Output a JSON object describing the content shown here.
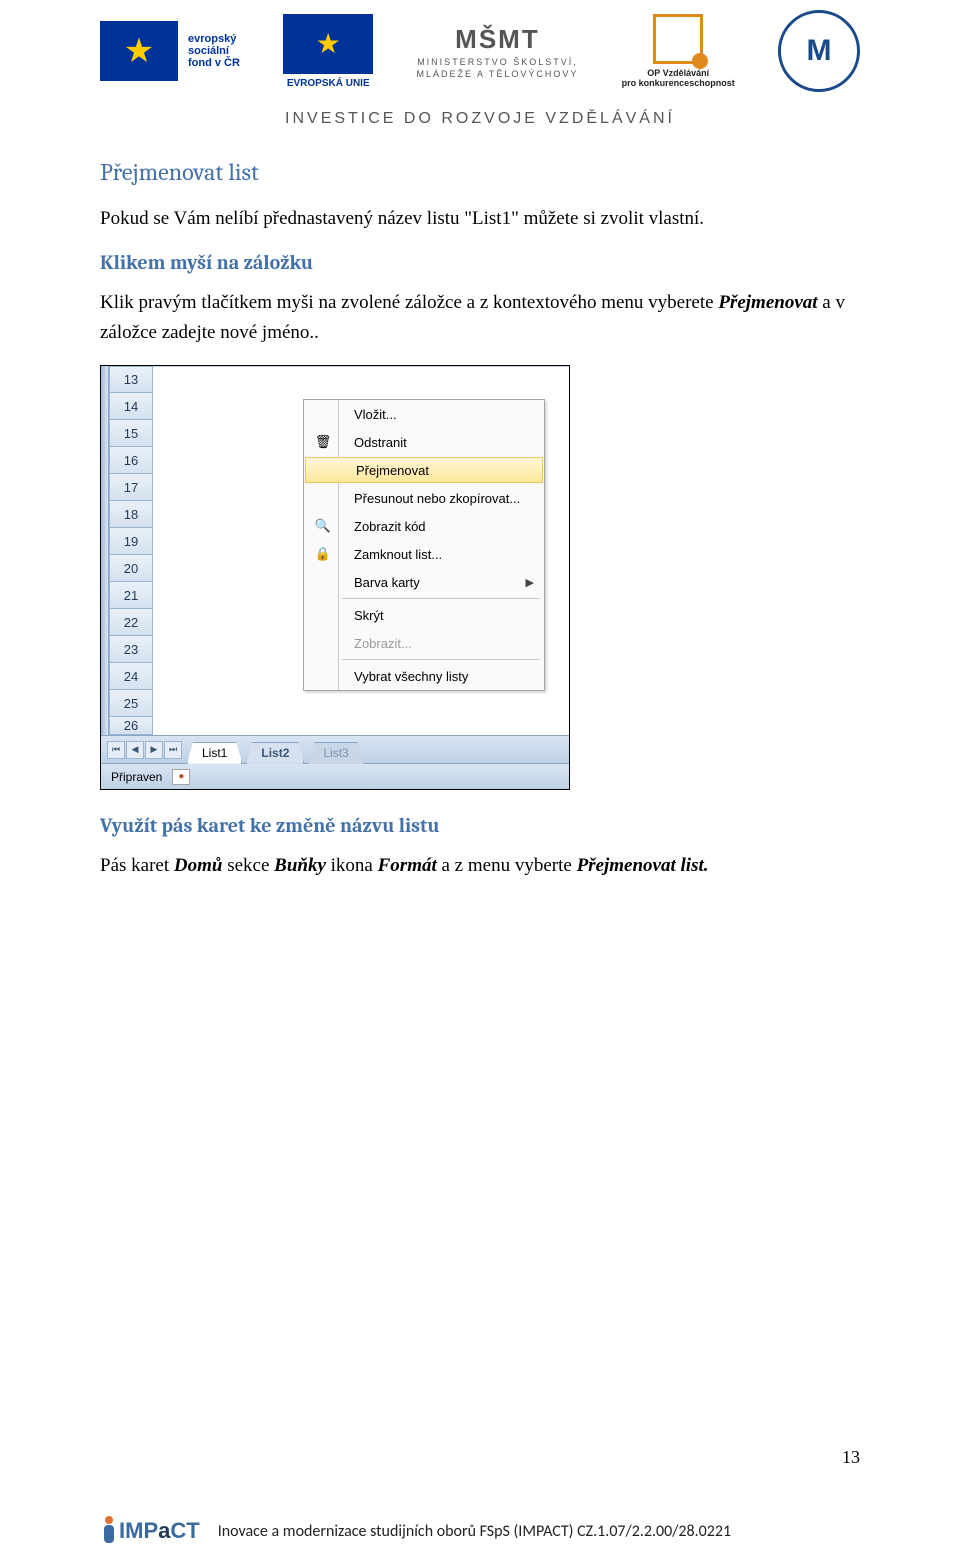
{
  "header": {
    "esf_line1": "evropský",
    "esf_line2": "sociální",
    "esf_line3": "fond v ČR",
    "eu_label": "EVROPSKÁ UNIE",
    "msmt_logo": "MŠMT",
    "msmt_line1": "MINISTERSTVO ŠKOLSTVÍ,",
    "msmt_line2": "MLÁDEŽE A TĚLOVÝCHOVY",
    "opvk_line1": "OP Vzdělávání",
    "opvk_line2": "pro konkurenceschopnost",
    "muni_initials": "M",
    "investice": "INVESTICE DO ROZVOJE VZDĚLÁVÁNÍ"
  },
  "section_title": "Přejmenovat list",
  "para1": "Pokud se Vám nelíbí přednastavený název listu \"List1\" můžete si zvolit vlastní.",
  "sub1_title": "Klikem myší na záložku",
  "para2_pre": "Klik pravým tlačítkem myši na zvolené záložce a z kontextového menu vyberete ",
  "para2_em": "Přejmenovat",
  "para2_post": " a v záložce zadejte nové jméno..",
  "excel": {
    "rows": [
      "13",
      "14",
      "15",
      "16",
      "17",
      "18",
      "19",
      "20",
      "21",
      "22",
      "23",
      "24",
      "25",
      "26"
    ],
    "menu": {
      "insert": "Vložit...",
      "delete": "Odstranit",
      "rename": "Přejmenovat",
      "move": "Přesunout nebo zkopírovat...",
      "viewcode": "Zobrazit kód",
      "lock": "Zamknout list...",
      "color": "Barva karty",
      "hide": "Skrýt",
      "show": "Zobrazit...",
      "selectall": "Vybrat všechny listy"
    },
    "tabs": {
      "t1": "List1",
      "t2": "List2",
      "t3": "List3"
    },
    "status": "Připraven"
  },
  "sub2_title": "Využít pás karet ke změně názvu listu",
  "para3_a": "Pás karet ",
  "para3_b": "Domů",
  "para3_c": " sekce ",
  "para3_d": "Buňky",
  "para3_e": " ikona ",
  "para3_f": "Formát",
  "para3_g": " a z menu vyberte ",
  "para3_h": "Přejmenovat list.",
  "page_number": "13",
  "footer": {
    "impact": "IMPaCT",
    "text": "Inovace a modernizace studijních oborů FSpS (IMPACT) CZ.1.07/2.2.00/28.0221"
  }
}
